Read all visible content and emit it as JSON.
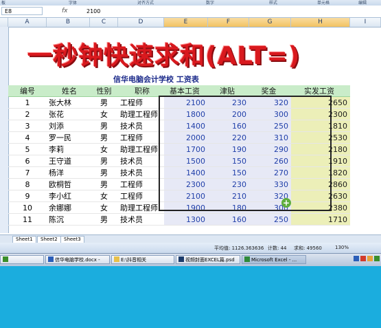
{
  "ribbon": {
    "labels": [
      "字体",
      "对齐方式",
      "数字",
      "样式",
      "单元格",
      "编辑"
    ]
  },
  "formula_bar": {
    "name_box": "E8",
    "fx": "fx",
    "value": "2100"
  },
  "columns": [
    "A",
    "B",
    "C",
    "D",
    "E",
    "F",
    "G",
    "H",
    "I"
  ],
  "banner": "一秒钟快速求和(ALT=)",
  "subtitle": "信华电脑会计学校   工资表",
  "table": {
    "headers": [
      "编号",
      "姓名",
      "性别",
      "职称",
      "基本工资",
      "津贴",
      "奖金",
      "实发工资"
    ],
    "rows": [
      [
        "1",
        "张大林",
        "男",
        "工程师",
        "2100",
        "230",
        "320",
        "2650"
      ],
      [
        "2",
        "张花",
        "女",
        "助理工程师",
        "1800",
        "200",
        "300",
        "2300"
      ],
      [
        "3",
        "刘添",
        "男",
        "技术员",
        "1400",
        "160",
        "250",
        "1810"
      ],
      [
        "4",
        "罗一民",
        "男",
        "工程师",
        "2000",
        "220",
        "310",
        "2530"
      ],
      [
        "5",
        "李莉",
        "女",
        "助理工程师",
        "1700",
        "190",
        "290",
        "2180"
      ],
      [
        "6",
        "王守道",
        "男",
        "技术员",
        "1500",
        "150",
        "260",
        "1910"
      ],
      [
        "7",
        "杨洋",
        "男",
        "技术员",
        "1400",
        "150",
        "270",
        "1820"
      ],
      [
        "8",
        "欧桐哲",
        "男",
        "工程师",
        "2300",
        "230",
        "330",
        "2860"
      ],
      [
        "9",
        "李小红",
        "女",
        "工程师",
        "2100",
        "210",
        "320",
        "2630"
      ],
      [
        "10",
        "余娜娜",
        "女",
        "助理工程师",
        "1900",
        "180",
        "300",
        "2380"
      ],
      [
        "11",
        "陈沉",
        "男",
        "技术员",
        "1300",
        "160",
        "250",
        "1710"
      ]
    ]
  },
  "sheet_tabs": [
    "Sheet1",
    "Sheet2",
    "Sheet3"
  ],
  "status": {
    "average": "平均值: 1126.363636",
    "count": "计数: 44",
    "sum": "求和: 49560",
    "zoom": "130%"
  },
  "taskbar": {
    "items": [
      "信华电脑学校.docx -",
      "E:\\抖音相关",
      "视频封面EXCEL篇.psd",
      "Microsoft Excel - ..."
    ]
  },
  "colors": {
    "header_green": "#c9ecc9",
    "sum_yellow": "#ecefb8",
    "banner_red": "#d9191e",
    "desktop_blue": "#1badde"
  }
}
